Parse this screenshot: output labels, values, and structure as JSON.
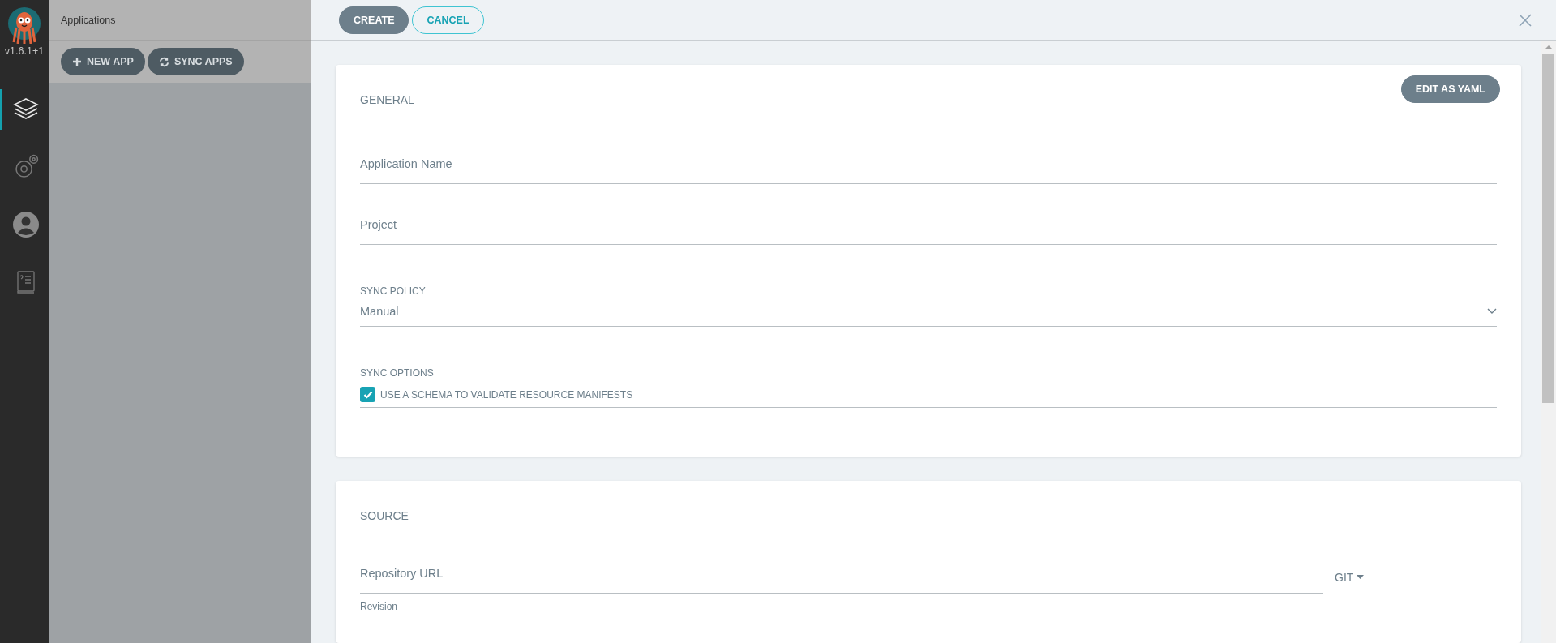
{
  "sidebar": {
    "version": "v1.6.1+1",
    "items": [
      {
        "kind": "layers",
        "selected": true
      },
      {
        "kind": "gears",
        "selected": false
      },
      {
        "kind": "user",
        "selected": false
      },
      {
        "kind": "docs",
        "selected": false
      }
    ]
  },
  "applications": {
    "title": "Applications",
    "buttons": [
      {
        "kind": "plus",
        "label": "NEW APP"
      },
      {
        "kind": "sync",
        "label": "SYNC APPS"
      }
    ]
  },
  "toolbar": {
    "buttons": [
      {
        "kind": "primary",
        "label": "CREATE"
      },
      {
        "kind": "outline",
        "label": "CANCEL"
      }
    ]
  },
  "general": {
    "title": "GENERAL",
    "edit_button": "EDIT AS YAML",
    "fields": [
      {
        "kind": "text",
        "placeholder": "Application Name"
      },
      {
        "kind": "text",
        "placeholder": "Project"
      },
      {
        "kind": "select",
        "label": "SYNC POLICY",
        "value": "Manual"
      },
      {
        "kind": "checks",
        "label": "SYNC OPTIONS",
        "options": [
          {
            "label": "USE A SCHEMA TO VALIDATE RESOURCE MANIFESTS",
            "checked": true
          }
        ]
      }
    ]
  },
  "source": {
    "title": "SOURCE",
    "fields": [
      {
        "kind": "repo",
        "placeholder": "Repository URL",
        "type": "GIT"
      },
      {
        "kind": "text",
        "placeholder": "Revision"
      }
    ]
  }
}
